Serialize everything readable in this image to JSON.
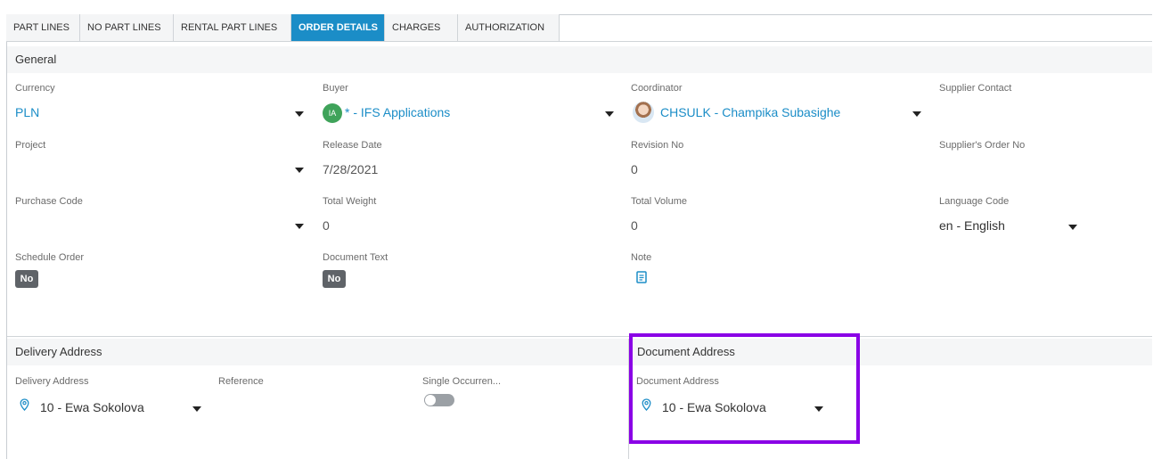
{
  "tabs": [
    {
      "label": "PART LINES"
    },
    {
      "label": "NO PART LINES"
    },
    {
      "label": "RENTAL PART LINES"
    },
    {
      "label": "ORDER DETAILS"
    },
    {
      "label": "CHARGES"
    },
    {
      "label": "AUTHORIZATION"
    }
  ],
  "general": {
    "title": "General",
    "currency": {
      "label": "Currency",
      "value": "PLN"
    },
    "buyer": {
      "label": "Buyer",
      "initials": "IA",
      "value": "* - IFS Applications"
    },
    "coordinator": {
      "label": "Coordinator",
      "value": "CHSULK - Champika Subasighe"
    },
    "supplier_contact": {
      "label": "Supplier Contact"
    },
    "project": {
      "label": "Project"
    },
    "release_date": {
      "label": "Release Date",
      "value": "7/28/2021"
    },
    "revision_no": {
      "label": "Revision No",
      "value": "0"
    },
    "suppliers_order_no": {
      "label": "Supplier's Order No"
    },
    "purchase_code": {
      "label": "Purchase Code"
    },
    "total_weight": {
      "label": "Total Weight",
      "value": "0"
    },
    "total_volume": {
      "label": "Total Volume",
      "value": "0"
    },
    "language_code": {
      "label": "Language Code",
      "value": "en - English"
    },
    "schedule_order": {
      "label": "Schedule Order",
      "value": "No"
    },
    "document_text": {
      "label": "Document Text",
      "value": "No"
    },
    "note": {
      "label": "Note",
      "icon": "note-icon"
    }
  },
  "delivery": {
    "title": "Delivery Address",
    "address": {
      "label": "Delivery Address",
      "value": "10 - Ewa Sokolova",
      "icon": "location-pin-icon"
    },
    "reference": {
      "label": "Reference"
    },
    "single_occurrence": {
      "label": "Single Occurren..."
    }
  },
  "document": {
    "title": "Document Address",
    "address": {
      "label": "Document Address",
      "value": "10 - Ewa Sokolova",
      "icon": "location-pin-icon"
    }
  },
  "colors": {
    "accent": "#1b8dc7",
    "highlight": "#8a00e6",
    "avatar": "#3fa35a",
    "badge": "#5f6368"
  }
}
